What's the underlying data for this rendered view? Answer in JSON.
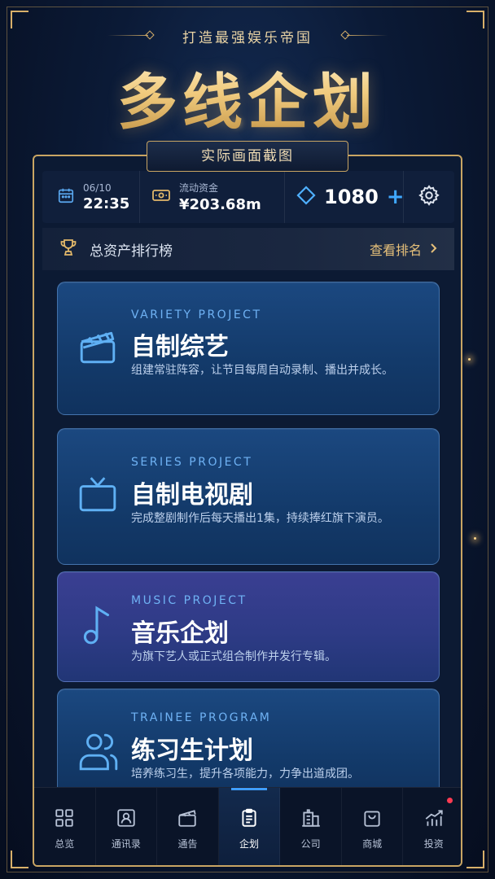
{
  "header": {
    "slogan": "打造最强娱乐帝国",
    "title": "多线企划",
    "screenshot_tag": "实际画面截图"
  },
  "status": {
    "date": "06/10",
    "time": "22:35",
    "money_label": "流动资金",
    "money_value": "¥203.68m",
    "gems": "1080",
    "plus": "+"
  },
  "ranking": {
    "title": "总资产排行榜",
    "link": "查看排名"
  },
  "projects": [
    {
      "en": "VARIETY PROJECT",
      "title": "自制综艺",
      "desc": "组建常驻阵容，让节目每周自动录制、播出并成长。",
      "icon": "clapperboard-icon"
    },
    {
      "en": "SERIES PROJECT",
      "title": "自制电视剧",
      "desc": "完成整剧制作后每天播出1集，持续捧红旗下演员。",
      "icon": "tv-icon"
    },
    {
      "en": "MUSIC PROJECT",
      "title": "音乐企划",
      "desc": "为旗下艺人或正式组合制作并发行专辑。",
      "icon": "music-note-icon"
    },
    {
      "en": "TRAINEE PROGRAM",
      "title": "练习生计划",
      "desc": "培养练习生，提升各项能力，力争出道成团。",
      "icon": "people-icon"
    }
  ],
  "nav": [
    {
      "label": "总览",
      "icon": "grid-icon"
    },
    {
      "label": "通讯录",
      "icon": "contacts-icon"
    },
    {
      "label": "通告",
      "icon": "clapperboard-icon"
    },
    {
      "label": "企划",
      "icon": "clipboard-icon",
      "active": true
    },
    {
      "label": "公司",
      "icon": "building-icon"
    },
    {
      "label": "商城",
      "icon": "shopping-bag-icon"
    },
    {
      "label": "投资",
      "icon": "chart-icon",
      "badge": true
    }
  ],
  "colors": {
    "gold": "#d8b06a",
    "accent_blue": "#3f9dff",
    "card_blue": "#133a6a",
    "card_purple": "#2e3b86"
  }
}
